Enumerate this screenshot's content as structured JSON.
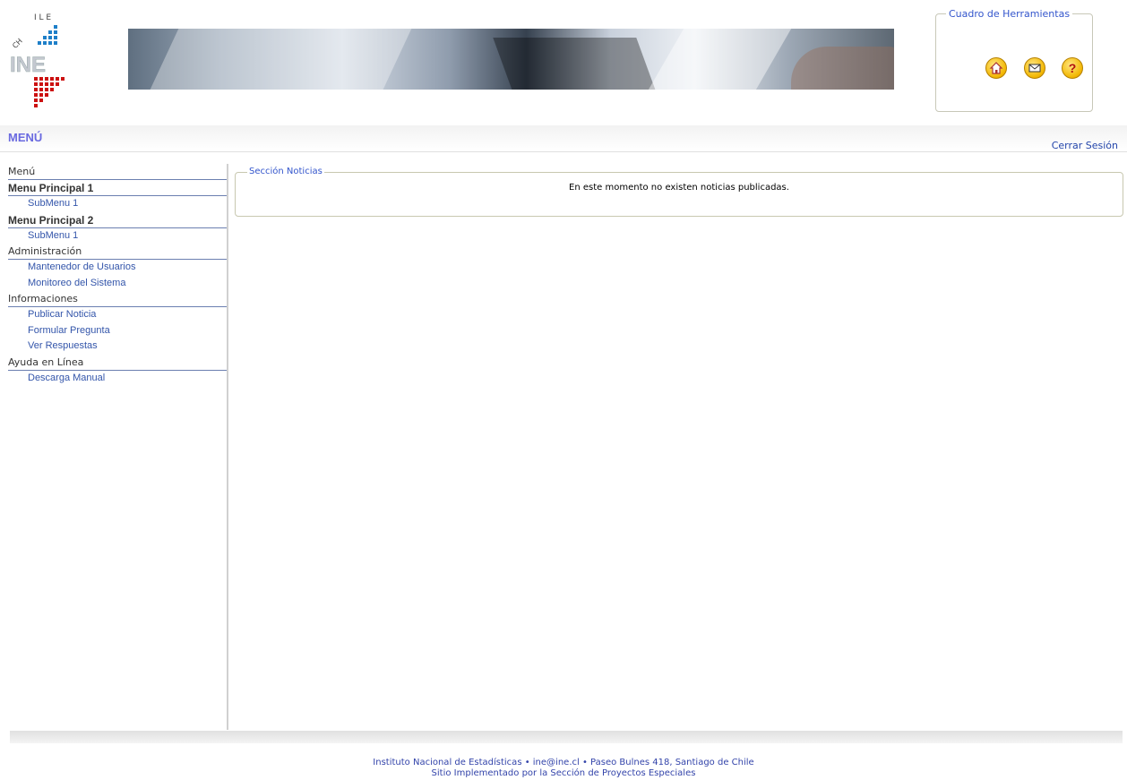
{
  "header": {
    "logo_text": "INE",
    "logo_country": "CHILE",
    "toolbox_title": "Cuadro de Herramientas",
    "tools": [
      {
        "icon": "home-icon"
      },
      {
        "icon": "mail-icon"
      },
      {
        "icon": "help-icon"
      }
    ]
  },
  "menubar": {
    "title": "MENÚ",
    "logout_label": "Cerrar Sesión"
  },
  "sidebar": {
    "sections": [
      {
        "label": "Menú",
        "items": []
      },
      {
        "label": "Menu Principal 1",
        "items": [
          {
            "label": "SubMenu 1"
          }
        ]
      },
      {
        "label": "Menu Principal 2",
        "items": [
          {
            "label": "SubMenu 1"
          }
        ]
      },
      {
        "label": "Administración",
        "items": [
          {
            "label": "Mantenedor de Usuarios"
          },
          {
            "label": "Monitoreo del Sistema"
          }
        ]
      },
      {
        "label": "Informaciones",
        "items": [
          {
            "label": "Publicar Noticia"
          },
          {
            "label": "Formular Pregunta"
          },
          {
            "label": "Ver Respuestas"
          }
        ]
      },
      {
        "label": "Ayuda en Línea",
        "items": [
          {
            "label": "Descarga Manual"
          }
        ]
      }
    ]
  },
  "news": {
    "title": "Sección Noticias",
    "message": "En este momento no existen noticias publicadas."
  },
  "footer": {
    "line1": "Instituto Nacional de Estadísticas • ine@ine.cl • Paseo Bulnes 418, Santiago de Chile",
    "line2": "Sitio Implementado por la Sección de Proyectos Especiales"
  },
  "colors": {
    "accent": "#3355cc",
    "menu_title": "#6a6ae0",
    "logo_blue": "#1e7fc8",
    "logo_red": "#cc1111",
    "icon_yellow": "#f2b600"
  }
}
